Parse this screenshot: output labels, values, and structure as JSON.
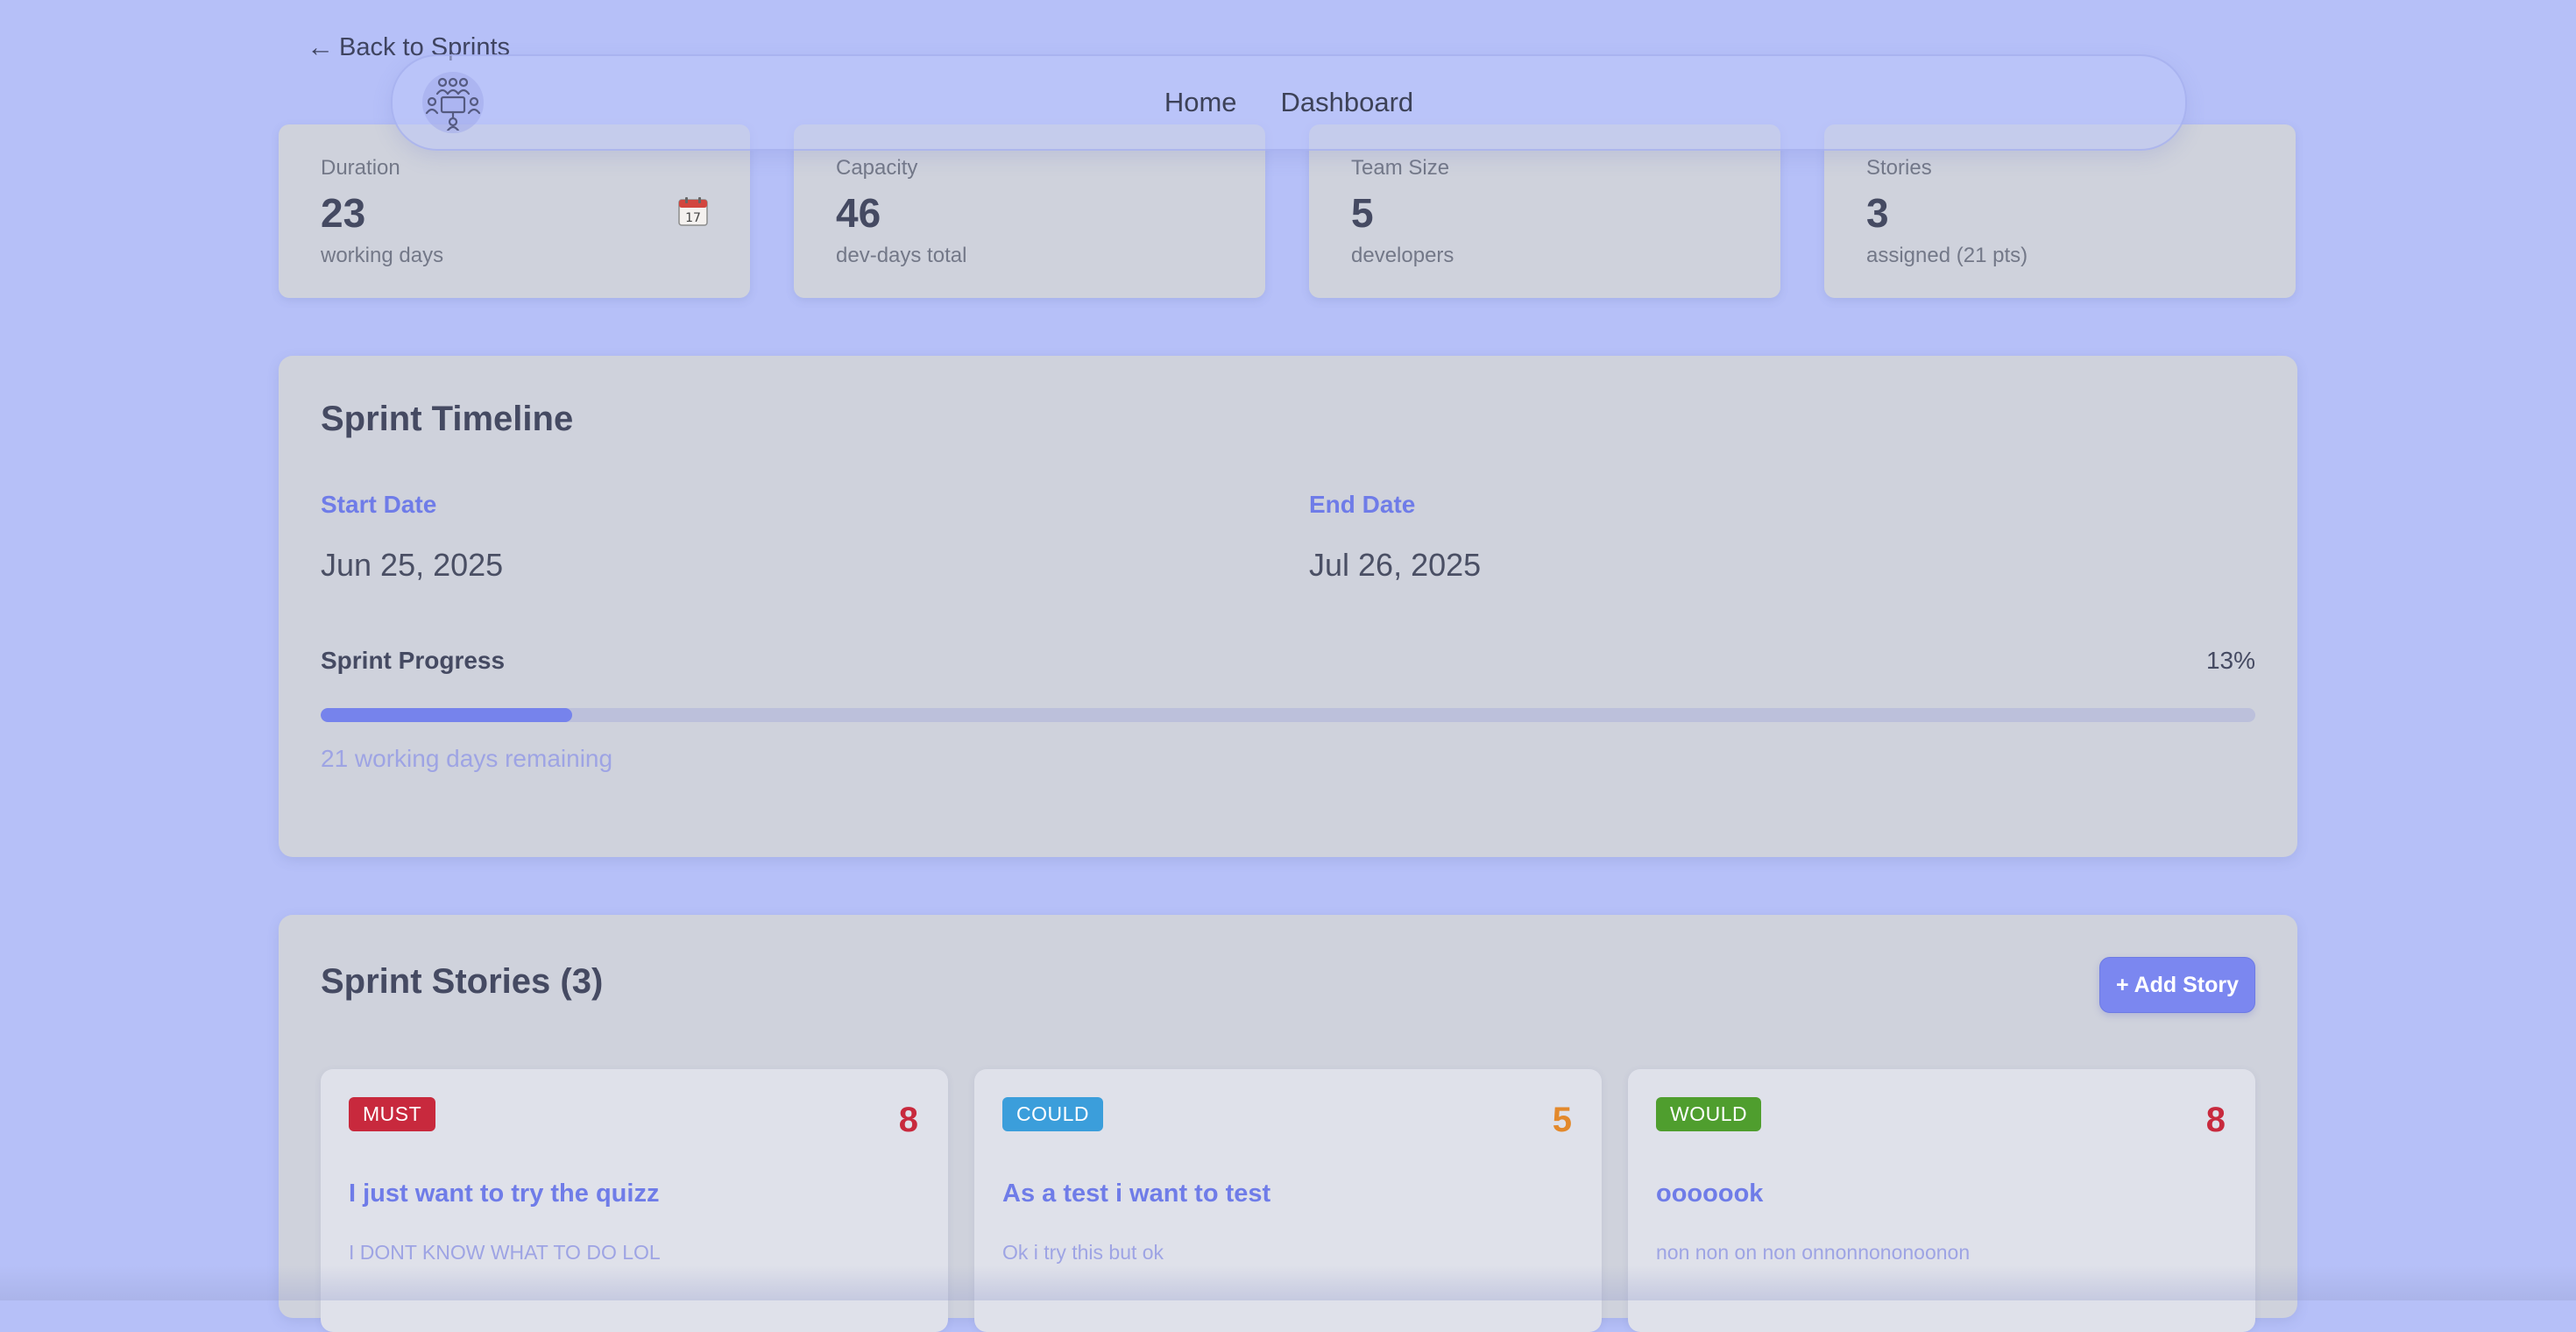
{
  "back_link": {
    "label": "Back to Sprints"
  },
  "nav": {
    "logo_icon": "team-meeting-icon",
    "links": [
      "Home",
      "Dashboard"
    ]
  },
  "stats": [
    {
      "label": "Duration",
      "value": "23",
      "sub": "working days",
      "icon": "calendar-icon"
    },
    {
      "label": "Capacity",
      "value": "46",
      "sub": "dev-days total"
    },
    {
      "label": "Team Size",
      "value": "5",
      "sub": "developers"
    },
    {
      "label": "Stories",
      "value": "3",
      "sub": "assigned (21 pts)"
    }
  ],
  "timeline": {
    "title": "Sprint Timeline",
    "start_label": "Start Date",
    "start_value": "Jun 25, 2025",
    "end_label": "End Date",
    "end_value": "Jul 26, 2025",
    "progress_label": "Sprint Progress",
    "progress_percent_text": "13%",
    "progress_fraction": 0.13,
    "remaining_text": "21 working days remaining"
  },
  "stories": {
    "title": "Sprint Stories (3)",
    "add_button": "+ Add Story",
    "items": [
      {
        "priority": "MUST",
        "priority_color": "#c8293d",
        "points": "8",
        "points_color": "#c8293d",
        "title": "I just want to try the quizz",
        "description": "I DONT KNOW WHAT TO DO LOL"
      },
      {
        "priority": "COULD",
        "priority_color": "#3b9edb",
        "points": "5",
        "points_color": "#e3892c",
        "title": "As a test i want to test",
        "description": "Ok i try this but ok"
      },
      {
        "priority": "WOULD",
        "priority_color": "#4f9e2e",
        "points": "8",
        "points_color": "#c8293d",
        "title": "ooooook",
        "description": "non non on non onnonnononoonon"
      }
    ]
  },
  "colors": {
    "background": "#b6c0f8",
    "card": "#cfd2dc",
    "accent": "#7683ec"
  }
}
